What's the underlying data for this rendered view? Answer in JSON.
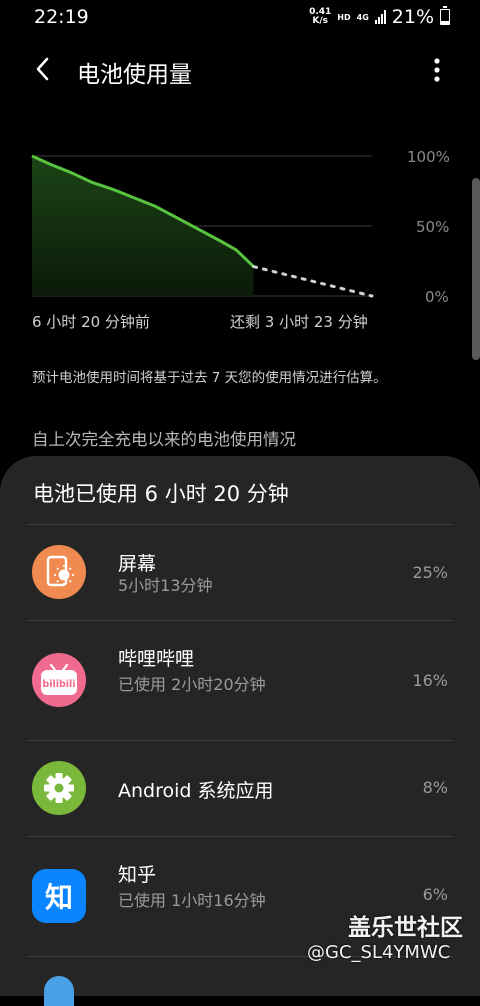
{
  "status_bar": {
    "time": "22:19",
    "net_speed_value": "0.41",
    "net_speed_unit": "K/s",
    "hd_label": "HD",
    "network_label": "4G",
    "battery_percent": "21%"
  },
  "app_bar": {
    "title": "电池使用量",
    "back_icon": "chevron-left-icon",
    "more_icon": "more-vertical-icon"
  },
  "chart_data": {
    "type": "area",
    "y_tick_labels": [
      "100%",
      "50%",
      "0%"
    ],
    "ylim": [
      0,
      100
    ],
    "x_start_label": "6 小时 20 分钟前",
    "x_end_label": "还剩 3 小时 23 分钟",
    "x_range_hours": [
      -6.33,
      3.38
    ],
    "actual": {
      "x": [
        -6.33,
        -5.8,
        -5.2,
        -4.6,
        -4.0,
        -3.4,
        -2.8,
        -2.2,
        -1.6,
        -1.0,
        -0.5,
        0
      ],
      "y": [
        100,
        94,
        88,
        81,
        76,
        70,
        64,
        56,
        48,
        40,
        33,
        21
      ]
    },
    "projected": {
      "x": [
        0,
        3.38
      ],
      "y": [
        21,
        0
      ]
    },
    "colors": {
      "line": "#58c43f",
      "fill_top": "#1c4416",
      "projected": "#d0d0d0",
      "grid": "#3a3a3a"
    },
    "grid": true
  },
  "estimate_note": "预计电池使用时间将基于过去 7 天您的使用情况进行估算。",
  "section_header": "自上次完全充电以来的电池使用情况",
  "sheet": {
    "title": "电池已使用 6 小时 20 分钟",
    "apps": [
      {
        "name": "屏幕",
        "sub": "5小时13分钟",
        "percent": "25%",
        "icon": "screen-brightness-icon",
        "icon_color": "#f08a50"
      },
      {
        "name": "哔哩哔哩",
        "sub": "已使用 2小时20分钟",
        "percent": "16%",
        "icon": "bilibili-icon",
        "icon_text": "bilibili",
        "icon_color": "#f06a8f"
      },
      {
        "name": "Android 系统应用",
        "sub": "",
        "percent": "8%",
        "icon": "gear-icon",
        "icon_color": "#7ab83c"
      },
      {
        "name": "知乎",
        "sub": "已使用 1小时16分钟",
        "percent": "6%",
        "icon": "zhihu-icon",
        "icon_text": "知",
        "icon_color": "#0a84ff"
      }
    ]
  },
  "watermark": {
    "title": "盖乐世社区",
    "user": "@GC_SL4YMWC"
  }
}
